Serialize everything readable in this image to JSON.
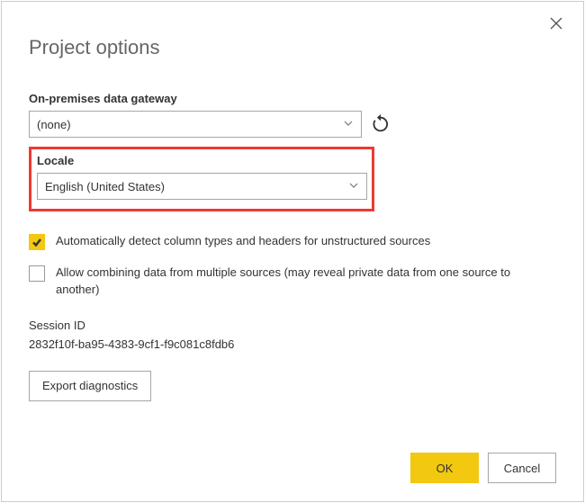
{
  "dialog": {
    "title": "Project options"
  },
  "gateway": {
    "label": "On-premises data gateway",
    "value": "(none)"
  },
  "locale": {
    "label": "Locale",
    "value": "English (United States)"
  },
  "options": {
    "autodetect": {
      "checked": true,
      "label": "Automatically detect column types and headers for unstructured sources"
    },
    "combine": {
      "checked": false,
      "label": "Allow combining data from multiple sources (may reveal private data from one source to another)"
    }
  },
  "session": {
    "label": "Session ID",
    "value": "2832f10f-ba95-4383-9cf1-f9c081c8fdb6"
  },
  "buttons": {
    "export": "Export diagnostics",
    "ok": "OK",
    "cancel": "Cancel"
  }
}
